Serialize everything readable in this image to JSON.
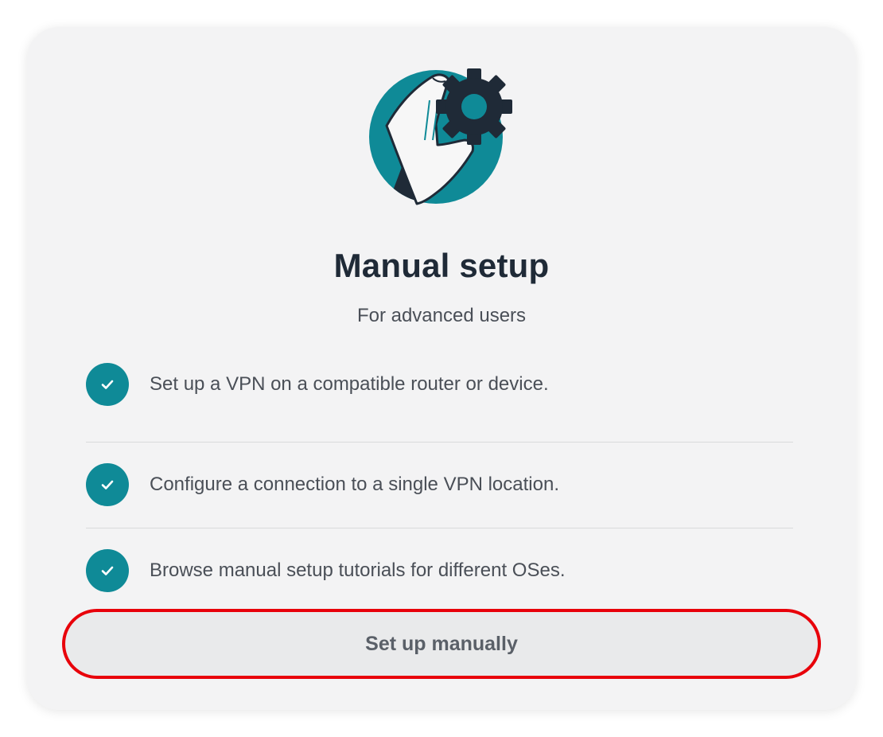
{
  "card": {
    "illustration_icon": "hand-holding-gear-icon",
    "title": "Manual setup",
    "subtitle": "For advanced users",
    "features": [
      {
        "icon": "checkmark-icon",
        "text": "Set up a VPN on a compatible router or device."
      },
      {
        "icon": "checkmark-icon",
        "text": "Configure a connection to a single VPN location."
      },
      {
        "icon": "checkmark-icon",
        "text": "Browse manual setup tutorials for different OSes."
      }
    ],
    "button_label": "Set up manually"
  },
  "colors": {
    "accent": "#0f8a97",
    "title": "#1f2a37",
    "text": "#4a4f57",
    "card_background": "#f3f3f4",
    "button_background": "#e9eaeb",
    "highlight_outline": "#e8000a"
  }
}
